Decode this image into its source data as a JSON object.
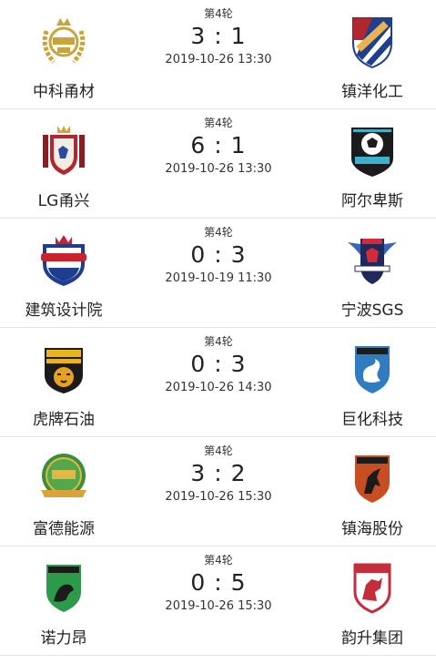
{
  "matches": [
    {
      "round": "第4轮",
      "score": "3 : 1",
      "time": "2019-10-26 13:30",
      "home": {
        "name": "中科甬材",
        "logo": "laurel-crest-icon",
        "color": "#c9a43a"
      },
      "away": {
        "name": "镇洋化工",
        "logo": "fc-soccer-shield-icon",
        "color": "#1f3e8c"
      }
    },
    {
      "round": "第4轮",
      "score": "6 : 1",
      "time": "2019-10-26 13:30",
      "home": {
        "name": "LG甬兴",
        "logo": "lion-coat-of-arms-icon",
        "color": "#b3262d"
      },
      "away": {
        "name": "阿尔卑斯",
        "logo": "soccer-ball-badge-icon",
        "color": "#3fb1c8"
      }
    },
    {
      "round": "第4轮",
      "score": "0 : 3",
      "time": "2019-10-19 11:30",
      "home": {
        "name": "建筑设计院",
        "logo": "green-player-crown-shield-icon",
        "color": "#1e3d8f"
      },
      "away": {
        "name": "宁波SGS",
        "logo": "winged-football-team-icon",
        "color": "#1e2a5c"
      }
    },
    {
      "round": "第4轮",
      "score": "0 : 3",
      "time": "2019-10-26 14:30",
      "home": {
        "name": "虎牌石油",
        "logo": "tiger-fc-badge-icon",
        "color": "#e8b51f"
      },
      "away": {
        "name": "巨化科技",
        "logo": "dragon-shield-icon",
        "color": "#2f7cc0"
      }
    },
    {
      "round": "第4轮",
      "score": "3 : 2",
      "time": "2019-10-26 15:30",
      "home": {
        "name": "富德能源",
        "logo": "soccer-2014-champions-badge-icon",
        "color": "#3a8f3a"
      },
      "away": {
        "name": "镇海股份",
        "logo": "unicorn-shield-icon",
        "color": "#c74d22"
      }
    },
    {
      "round": "第4轮",
      "score": "0 : 5",
      "time": "2019-10-26 15:30",
      "home": {
        "name": "诺力昂",
        "logo": "kirin-shield-icon",
        "color": "#2d9a4a"
      },
      "away": {
        "name": "韵升集团",
        "logo": "griffin-shield-icon",
        "color": "#c62d3b"
      }
    }
  ]
}
